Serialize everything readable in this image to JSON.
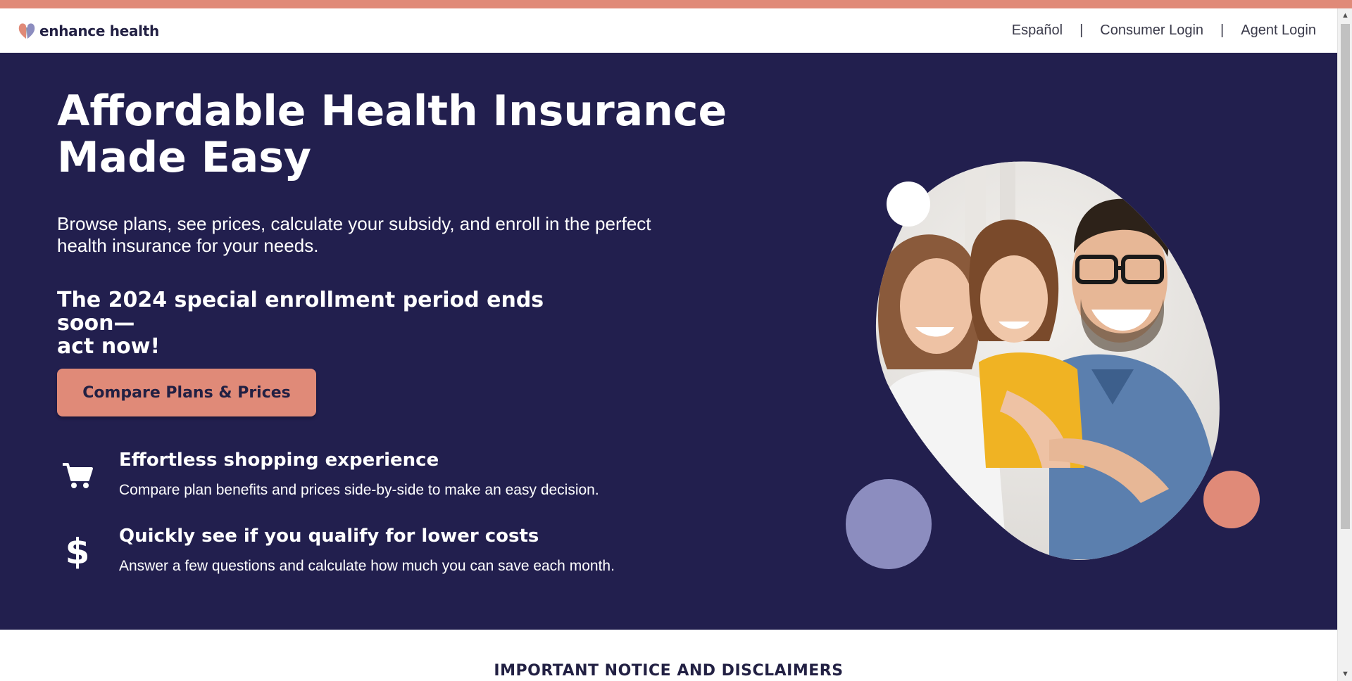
{
  "brand": {
    "name": "enhance health"
  },
  "nav": {
    "links": [
      {
        "label": "Español"
      },
      {
        "label": "Consumer Login"
      },
      {
        "label": "Agent Login"
      }
    ],
    "separator": "|"
  },
  "hero": {
    "title_line1": "Affordable Health Insurance",
    "title_line2": "Made Easy",
    "subtitle_line1": "Browse plans, see prices, calculate your subsidy, and enroll in the perfect",
    "subtitle_line2": "health insurance for your needs.",
    "cta_text_line1": "The 2024 special enrollment period ends soon—",
    "cta_text_line2": "act now!",
    "cta_button": "Compare Plans & Prices"
  },
  "features": [
    {
      "icon": "shopping-cart-icon",
      "title": "Effortless shopping experience",
      "description": "Compare plan benefits and prices side-by-side to make an easy decision."
    },
    {
      "icon": "dollar-sign-icon",
      "glyph": "$",
      "title": "Quickly see if you qualify for lower costs",
      "description": "Answer a few questions and calculate how much you can save each month."
    }
  ],
  "notice": {
    "title": "IMPORTANT NOTICE AND DISCLAIMERS"
  },
  "colors": {
    "accent": "#e08a78",
    "hero_bg": "#221f4e",
    "lavender": "#8c8dbf",
    "text_dark": "#222043"
  }
}
